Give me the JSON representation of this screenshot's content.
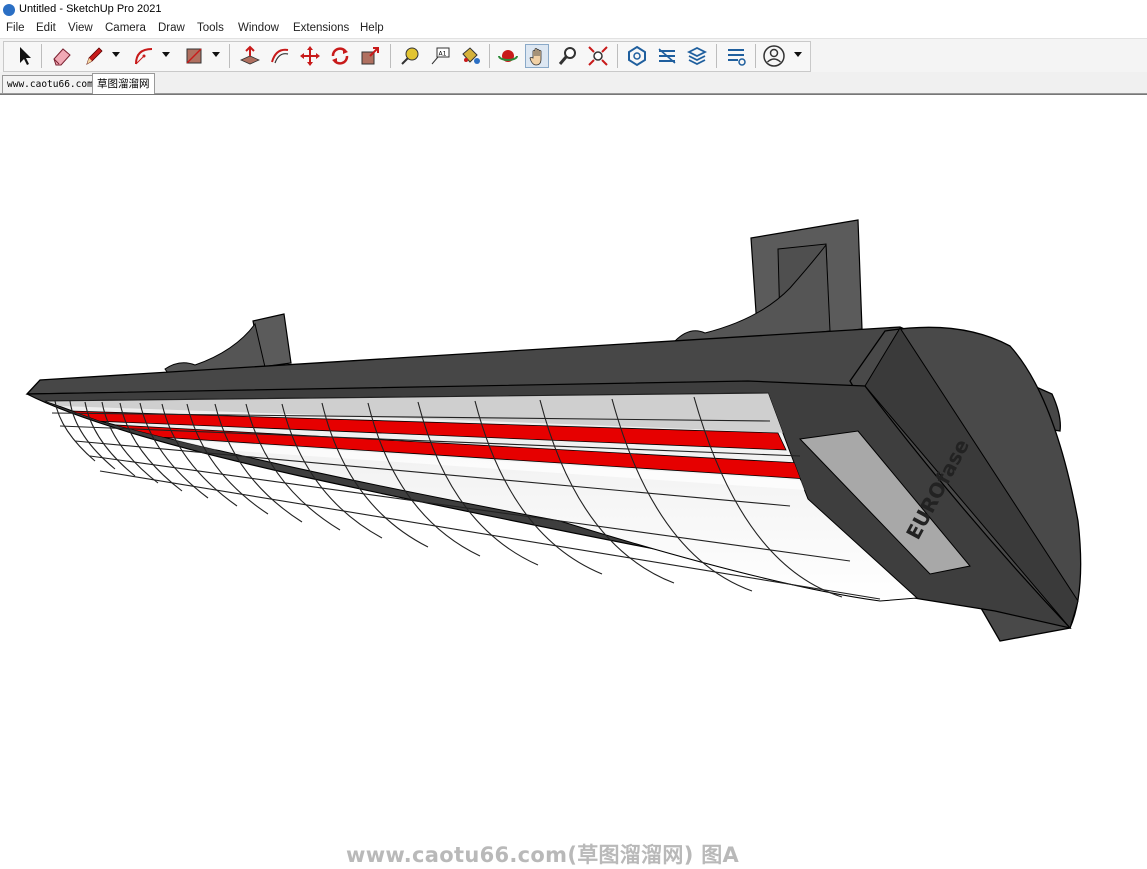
{
  "window": {
    "title": "Untitled - SketchUp Pro 2021"
  },
  "menu": [
    "File",
    "Edit",
    "View",
    "Camera",
    "Draw",
    "Tools",
    "Window",
    "Extensions",
    "Help"
  ],
  "toolbar": {
    "tools": [
      "select",
      "eraser",
      "line",
      "arc",
      "rectangle",
      "push-pull",
      "offset",
      "move",
      "rotate",
      "scale",
      "tape-measure",
      "text",
      "paint-bucket",
      "orbit",
      "pan",
      "zoom",
      "zoom-extents",
      "warehouse",
      "extension-warehouse",
      "layout",
      "extension-manager",
      "account"
    ],
    "active_tool": "pan"
  },
  "scene_tabs": [
    {
      "label": "www.caotu66.com",
      "active": false
    },
    {
      "label": "草图溜溜网",
      "active": true
    }
  ],
  "model": {
    "brand_label": "EUROfase"
  },
  "watermark": "www.caotu66.com(草图溜溜网) 图A",
  "colors": {
    "heater_body": "#4a4a4a",
    "heating_element": "#e00000",
    "viewport_bg": "#ffffff",
    "accent": "#2b6fc4"
  }
}
